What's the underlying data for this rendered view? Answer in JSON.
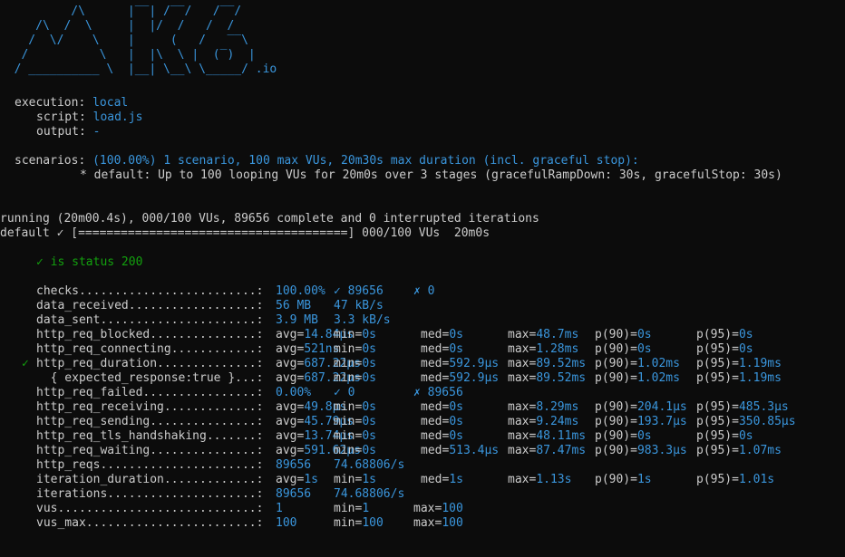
{
  "logo": "          /\\      |‾‾| /‾‾/   /‾‾/   \n     /\\  /  \\     |  |/  /   /  /    \n    /  \\/    \\    |     (   /   ‾‾\\  \n   /          \\   |  |\\  \\ |  (‾)  | \n  / __________ \\  |__| \\__\\ \\_____/ .io",
  "options": {
    "execution_label": "execution:",
    "execution_value": "local",
    "script_label": "script:",
    "script_value": "load.js",
    "output_label": "output:",
    "output_value": "-"
  },
  "scenarios": {
    "label": "scenarios:",
    "summary": "(100.00%) 1 scenario, 100 max VUs, 20m30s max duration (incl. graceful stop):",
    "detail": "* default: Up to 100 looping VUs for 20m0s over 3 stages (gracefulRampDown: 30s, gracefulStop: 30s)"
  },
  "status": {
    "running": "running (20m00.4s), 000/100 VUs, 89656 complete and 0 interrupted iterations",
    "progress": "default ✓ [======================================] 000/100 VUs  20m0s"
  },
  "check": "✓ is status 200",
  "metrics": [
    {
      "mark": "",
      "name": "checks.........................:",
      "cols": [
        "100.00%",
        "✓ 89656",
        "",
        "✗ 0",
        "",
        "",
        ""
      ]
    },
    {
      "mark": "",
      "name": "data_received..................:",
      "cols": [
        "56 MB",
        "47 kB/s",
        "",
        "",
        "",
        "",
        ""
      ]
    },
    {
      "mark": "",
      "name": "data_sent......................:",
      "cols": [
        "3.9 MB",
        "3.3 kB/s",
        "",
        "",
        "",
        "",
        ""
      ]
    },
    {
      "mark": "",
      "name": "http_req_blocked...............:",
      "cols": [
        "avg=14.84µs",
        "min=0s",
        "med=0s",
        "max=48.7ms",
        "p(90)=0s",
        "p(95)=0s",
        ""
      ]
    },
    {
      "mark": "",
      "name": "http_req_connecting............:",
      "cols": [
        "avg=521ns",
        "min=0s",
        "med=0s",
        "max=1.28ms",
        "p(90)=0s",
        "p(95)=0s",
        ""
      ]
    },
    {
      "mark": "✓",
      "name": "http_req_duration..............:",
      "cols": [
        "avg=687.22µs",
        "min=0s",
        "med=592.9µs",
        "max=89.52ms",
        "p(90)=1.02ms",
        "p(95)=1.19ms",
        ""
      ]
    },
    {
      "mark": "",
      "name": "  { expected_response:true }...:",
      "cols": [
        "avg=687.22µs",
        "min=0s",
        "med=592.9µs",
        "max=89.52ms",
        "p(90)=1.02ms",
        "p(95)=1.19ms",
        ""
      ]
    },
    {
      "mark": "",
      "name": "http_req_failed................:",
      "cols": [
        "0.00%",
        "✓ 0",
        "",
        "✗ 89656",
        "",
        "",
        ""
      ]
    },
    {
      "mark": "",
      "name": "http_req_receiving.............:",
      "cols": [
        "avg=49.8µs",
        "min=0s",
        "med=0s",
        "max=8.29ms",
        "p(90)=204.1µs",
        "p(95)=485.3µs",
        ""
      ]
    },
    {
      "mark": "",
      "name": "http_req_sending...............:",
      "cols": [
        "avg=45.79µs",
        "min=0s",
        "med=0s",
        "max=9.24ms",
        "p(90)=193.7µs",
        "p(95)=350.85µs",
        ""
      ]
    },
    {
      "mark": "",
      "name": "http_req_tls_handshaking.......:",
      "cols": [
        "avg=13.74µs",
        "min=0s",
        "med=0s",
        "max=48.11ms",
        "p(90)=0s",
        "p(95)=0s",
        ""
      ]
    },
    {
      "mark": "",
      "name": "http_req_waiting...............:",
      "cols": [
        "avg=591.62µs",
        "min=0s",
        "med=513.4µs",
        "max=87.47ms",
        "p(90)=983.3µs",
        "p(95)=1.07ms",
        ""
      ]
    },
    {
      "mark": "",
      "name": "http_reqs......................:",
      "cols": [
        "89656",
        "74.68806/s",
        "",
        "",
        "",
        "",
        ""
      ]
    },
    {
      "mark": "",
      "name": "iteration_duration.............:",
      "cols": [
        "avg=1s",
        "min=1s",
        "med=1s",
        "max=1.13s",
        "p(90)=1s",
        "p(95)=1.01s",
        ""
      ]
    },
    {
      "mark": "",
      "name": "iterations.....................:",
      "cols": [
        "89656",
        "74.68806/s",
        "",
        "",
        "",
        "",
        ""
      ]
    },
    {
      "mark": "",
      "name": "vus............................:",
      "cols": [
        "1",
        "min=1",
        "",
        "max=100",
        "",
        "",
        ""
      ]
    },
    {
      "mark": "",
      "name": "vus_max........................:",
      "cols": [
        "100",
        "min=100",
        "",
        "max=100",
        "",
        "",
        ""
      ]
    }
  ]
}
